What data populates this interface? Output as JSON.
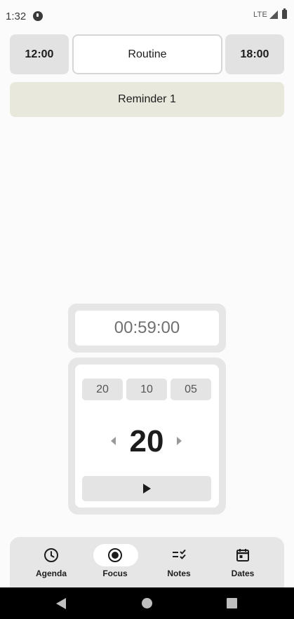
{
  "status_bar": {
    "time": "1:32",
    "network": "LTE"
  },
  "header": {
    "start_time": "12:00",
    "routine_label": "Routine",
    "end_time": "18:00"
  },
  "reminder": {
    "label": "Reminder 1"
  },
  "timer": {
    "display": "00:59:00"
  },
  "picker": {
    "presets": [
      "20",
      "10",
      "05"
    ],
    "value": "20"
  },
  "bottom_nav": {
    "items": [
      {
        "label": "Agenda",
        "icon": "clock-icon",
        "active": false
      },
      {
        "label": "Focus",
        "icon": "record-icon",
        "active": true
      },
      {
        "label": "Notes",
        "icon": "checklist-icon",
        "active": false
      },
      {
        "label": "Dates",
        "icon": "calendar-icon",
        "active": false
      }
    ]
  },
  "colors": {
    "reminder_bg": "#e9e8dc",
    "nav_bg": "#e6e6e6",
    "active_pill": "#ffffff"
  }
}
